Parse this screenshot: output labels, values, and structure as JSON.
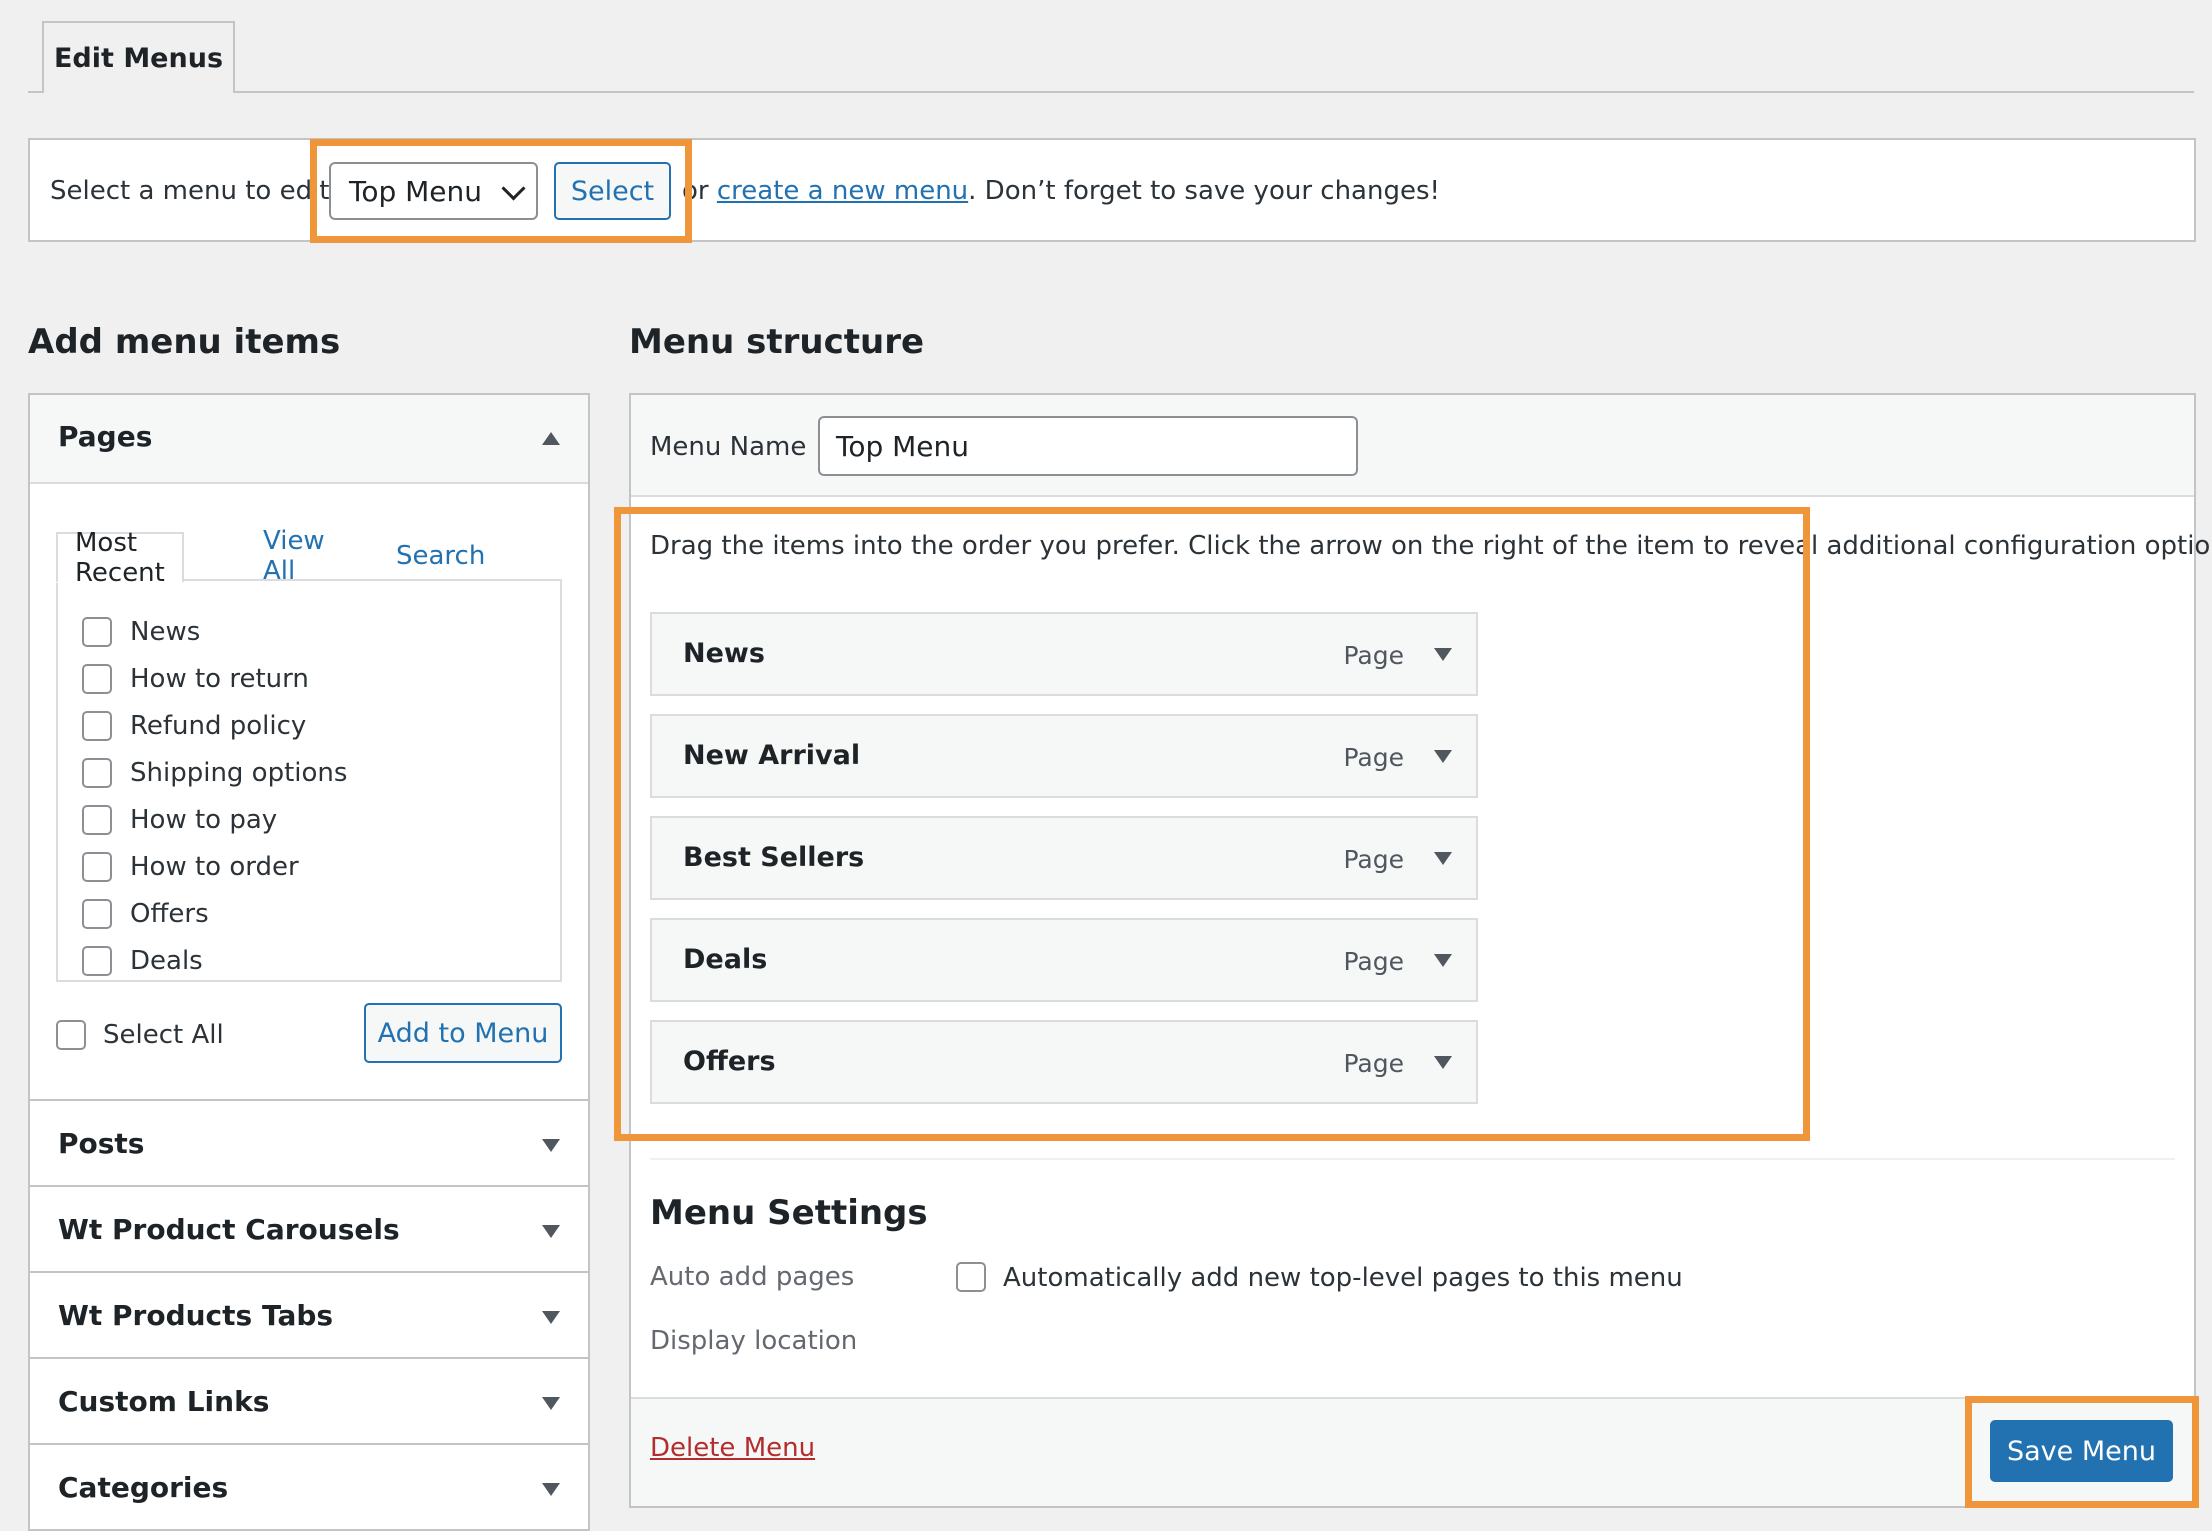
{
  "tab": {
    "label": "Edit Menus"
  },
  "select_bar": {
    "label": "Select a menu to edit:",
    "selected_menu": "Top Menu",
    "select_button": "Select",
    "or_prefix": "or",
    "create_link": "create a new menu",
    "suffix": ". Don’t forget to save your changes!"
  },
  "add_items": {
    "heading": "Add menu items",
    "pages": {
      "title": "Pages",
      "tabs": [
        "Most Recent",
        "View All",
        "Search"
      ],
      "items": [
        "News",
        "How to return",
        "Refund policy",
        "Shipping options",
        "How to pay",
        "How to order",
        "Offers",
        "Deals"
      ],
      "select_all": "Select All",
      "add_button": "Add to Menu"
    },
    "sections": [
      "Posts",
      "Wt Product Carousels",
      "Wt Products Tabs",
      "Custom Links",
      "Categories"
    ]
  },
  "structure": {
    "heading": "Menu structure",
    "menu_name_label": "Menu Name",
    "menu_name_value": "Top Menu",
    "instructions": "Drag the items into the order you prefer. Click the arrow on the right of the item to reveal additional configuration options.",
    "items": [
      {
        "title": "News",
        "type": "Page"
      },
      {
        "title": "New Arrival",
        "type": "Page"
      },
      {
        "title": "Best Sellers",
        "type": "Page"
      },
      {
        "title": "Deals",
        "type": "Page"
      },
      {
        "title": "Offers",
        "type": "Page"
      }
    ]
  },
  "settings": {
    "heading": "Menu Settings",
    "auto_add_label": "Auto add pages",
    "auto_add_text": "Automatically add new top-level pages to this menu",
    "display_location_label": "Display location"
  },
  "footer": {
    "delete_link": "Delete Menu",
    "save_button": "Save Menu"
  },
  "colors": {
    "highlight": "#f0963a",
    "primary": "#2271b1",
    "delete": "#b32d2e"
  }
}
